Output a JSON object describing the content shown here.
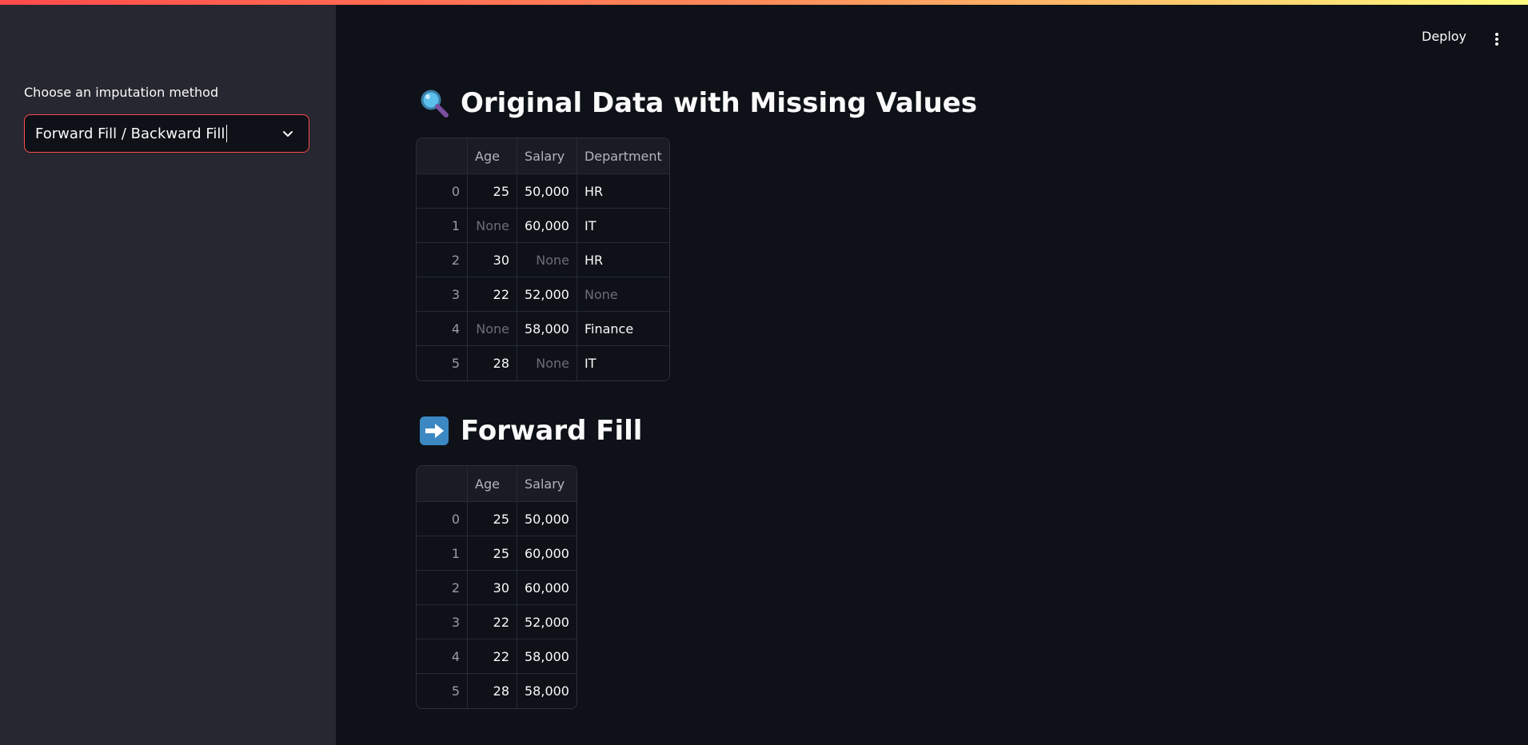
{
  "sidebar": {
    "select_label": "Choose an imputation method",
    "select_value": "Forward Fill / Backward Fill"
  },
  "header": {
    "deploy_label": "Deploy",
    "menu_icon": "kebab-menu-icon"
  },
  "section_original": {
    "emoji": "magnifying-glass-icon",
    "title": "Original Data with Missing Values",
    "columns": [
      "",
      "Age",
      "Salary",
      "Department"
    ],
    "rows": [
      [
        "0",
        "25",
        "50,000",
        "HR"
      ],
      [
        "1",
        "None",
        "60,000",
        "IT"
      ],
      [
        "2",
        "30",
        "None",
        "HR"
      ],
      [
        "3",
        "22",
        "52,000",
        "None"
      ],
      [
        "4",
        "None",
        "58,000",
        "Finance"
      ],
      [
        "5",
        "28",
        "None",
        "IT"
      ]
    ]
  },
  "section_ffill": {
    "emoji": "right-arrow-icon",
    "title": "Forward Fill",
    "columns": [
      "",
      "Age",
      "Salary"
    ],
    "rows": [
      [
        "0",
        "25",
        "50,000"
      ],
      [
        "1",
        "25",
        "60,000"
      ],
      [
        "2",
        "30",
        "60,000"
      ],
      [
        "3",
        "22",
        "52,000"
      ],
      [
        "4",
        "22",
        "58,000"
      ],
      [
        "5",
        "28",
        "58,000"
      ]
    ]
  },
  "colors": {
    "accent": "#ff4b4b",
    "background": "#0e1117",
    "sidebar": "#262730"
  }
}
